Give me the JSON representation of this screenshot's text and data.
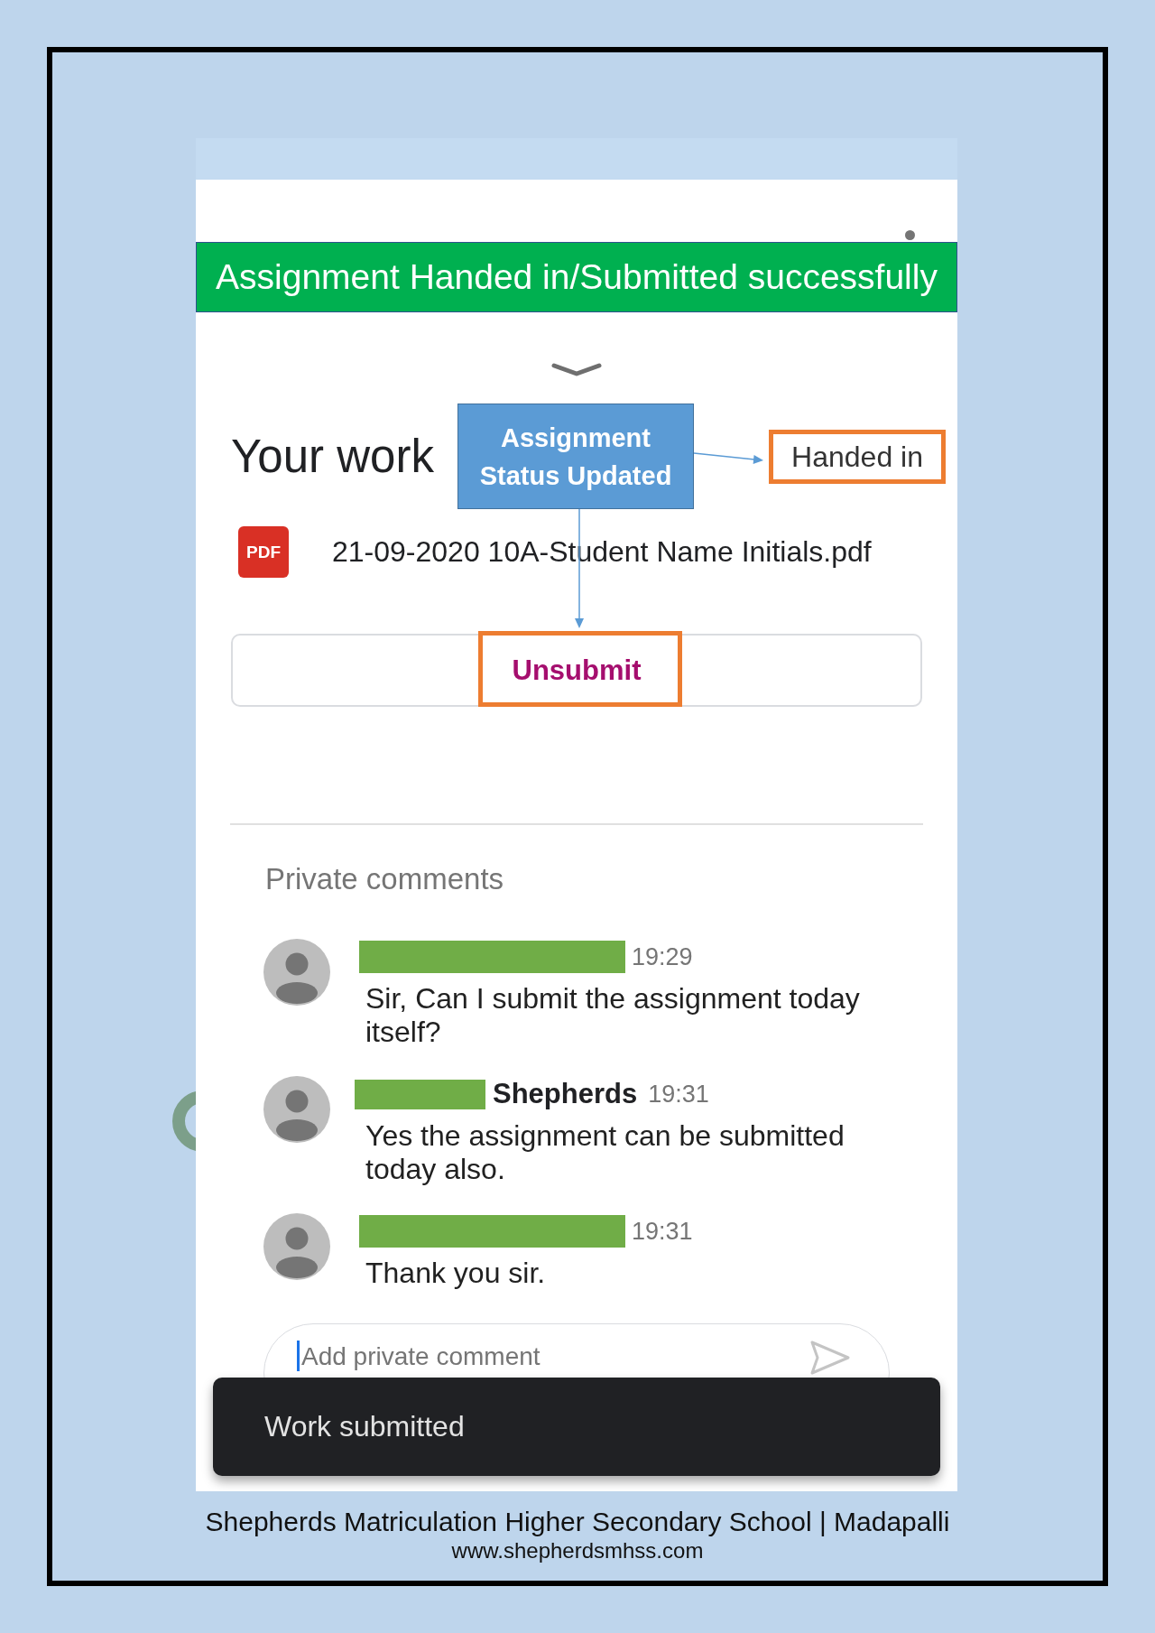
{
  "banner": {
    "text": "Assignment Handed in/Submitted successfully"
  },
  "header": {
    "title": "Your work",
    "status": {
      "text": "Handed in",
      "highlighted": true
    }
  },
  "annotation": {
    "text": "Assignment Status Updated"
  },
  "attachment": {
    "type_label": "PDF",
    "file_name": "21-09-2020 10A-Student Name Initials.pdf"
  },
  "unsubmit_button": {
    "label": "Unsubmit",
    "highlighted": true
  },
  "private_comments": {
    "title": "Private comments",
    "comments": [
      {
        "redacted": true,
        "time": "19:29",
        "text": "Sir, Can I submit the assignment today itself?"
      },
      {
        "redacted": true,
        "author": "Shepherds",
        "time": "19:31",
        "text": "Yes the assignment can be submitted today also."
      },
      {
        "redacted": true,
        "time": "19:31",
        "text": "Thank you sir."
      }
    ]
  },
  "comment_input": {
    "placeholder": "Add private comment",
    "focused": true
  },
  "snackbar": {
    "message": "Work submitted"
  },
  "footer": {
    "school": "Shepherds Matriculation Higher Secondary School | Madapalli",
    "website": "www.shepherdsmhss.com"
  }
}
